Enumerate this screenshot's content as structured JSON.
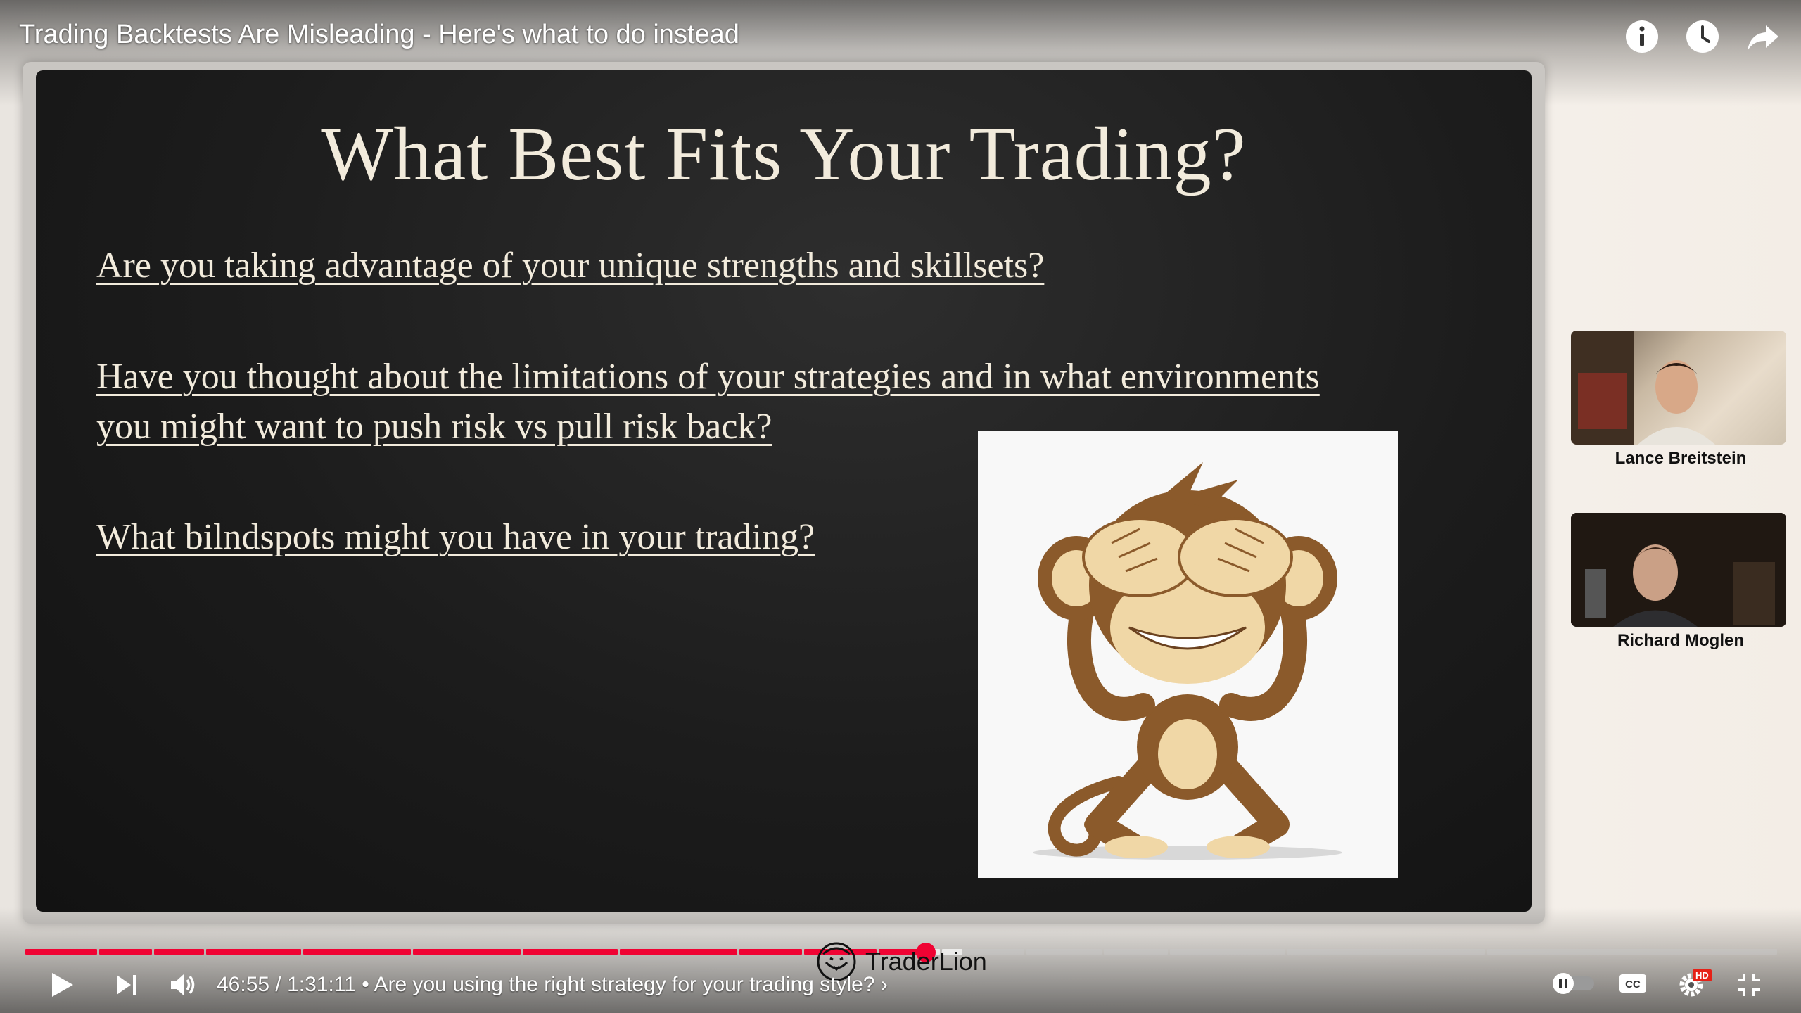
{
  "header": {
    "video_title": "Trading Backtests Are Misleading - Here's what to do instead",
    "icons": [
      "info-icon",
      "watch-later-icon",
      "share-icon"
    ]
  },
  "slide": {
    "title": "What Best Fits Your Trading?",
    "questions": [
      "Are you taking advantage of your unique strengths and skillsets?",
      "Have you thought about the limitations of your strategies and in what environments",
      "you might want to push risk vs pull risk back?",
      "What bilndspots might you have in your trading?"
    ],
    "image": "see-no-evil-monkey"
  },
  "participants": [
    {
      "name": "Lance Breitstein"
    },
    {
      "name": "Richard Moglen"
    }
  ],
  "player": {
    "current_time": "46:55",
    "duration": "1:31:11",
    "time_display": "46:55 / 1:31:11",
    "chapter": "• Are you using the right strategy for your trading style?",
    "chapter_chevron": "›",
    "played_fraction": 0.514,
    "buffered_fraction": 0.535,
    "progress_color": "#f00333",
    "watermark": "TraderLion",
    "quality_badge": "HD"
  }
}
